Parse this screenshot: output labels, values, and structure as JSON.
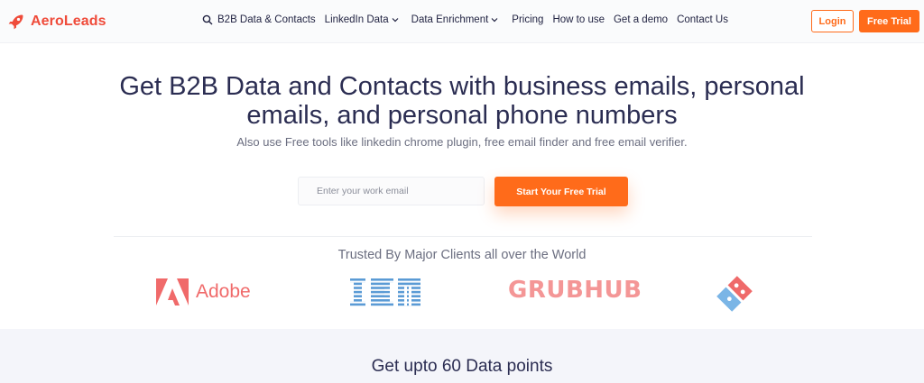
{
  "brand": {
    "name": "AeroLeads",
    "color": "#ef4b3a",
    "accent": "#ff6b1a"
  },
  "nav": {
    "items": [
      {
        "label": "B2B Data & Contacts",
        "icon": "search-icon"
      },
      {
        "label": "LinkedIn Data",
        "icon": "chevron-down-icon"
      },
      {
        "label": "Data Enrichment",
        "icon": "chevron-down-icon"
      },
      {
        "label": "Pricing"
      },
      {
        "label": "How to use"
      },
      {
        "label": "Get a demo"
      },
      {
        "label": "Contact Us"
      }
    ],
    "login_label": "Login",
    "free_trial_label": "Free Trial"
  },
  "hero": {
    "title": "Get B2B Data and Contacts with business emails, personal emails, and personal phone numbers",
    "subtitle": "Also use Free tools like linkedin chrome plugin, free email finder and free email verifier.",
    "email_placeholder": "Enter your work email",
    "cta_label": "Start Your Free Trial"
  },
  "clients": {
    "heading": "Trusted By Major Clients all over the World",
    "logos": [
      {
        "name": "Adobe",
        "icon": "adobe-logo"
      },
      {
        "name": "IBM",
        "icon": "ibm-logo"
      },
      {
        "name": "GRUBHUB",
        "icon": "grubhub-logo"
      },
      {
        "name": "Domino's",
        "icon": "dominos-logo"
      }
    ]
  },
  "features": {
    "heading": "Get upto 60 Data points"
  }
}
